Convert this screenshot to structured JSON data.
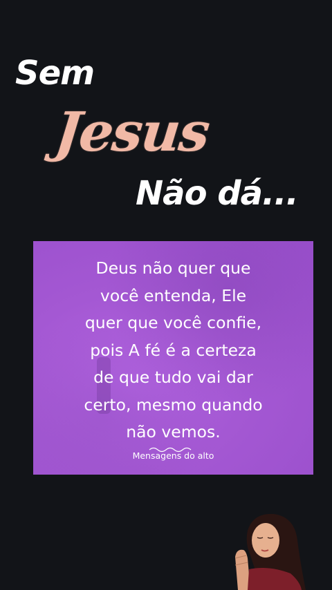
{
  "headline": {
    "line1": "Sem",
    "line2": "Jesus",
    "line3": "Não dá..."
  },
  "card": {
    "quote": "Deus não quer que\nvocê entenda, Ele\nquer que você confie,\npois A fé é a certeza\nde que tudo vai dar\ncerto, mesmo quando\nnão vemos.",
    "brand": "Mensagens do alto",
    "background_color": "#a458d3"
  },
  "colors": {
    "page_background": "#121418",
    "jesus_text": "#f1b9a6",
    "headline_text": "#ffffff"
  },
  "decor": {
    "person_image": "praying-woman-icon"
  }
}
